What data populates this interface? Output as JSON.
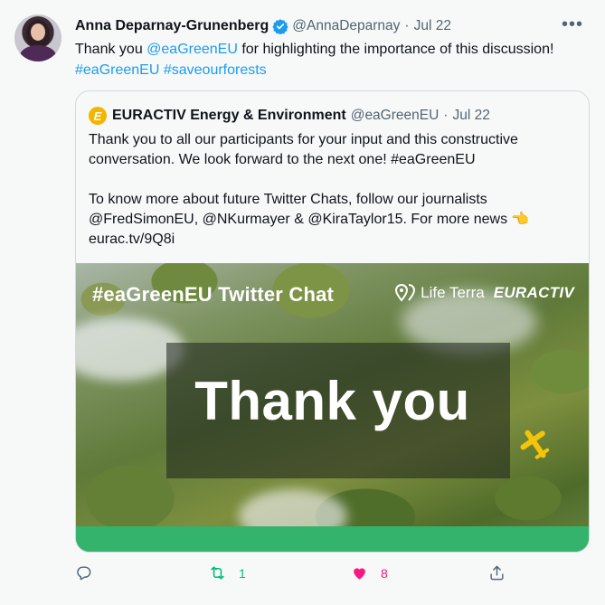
{
  "tweet": {
    "author_name": "Anna Deparnay-Grunenberg",
    "handle": "@AnnaDeparnay",
    "separator": "·",
    "date": "Jul 22",
    "more_icon": "more-horizontal-icon",
    "text_before": "Thank you ",
    "mention": "@eaGreenEU",
    "text_after": " for highlighting the importance of this discussion!",
    "hashtag1": "#eaGreenEU",
    "hashtag2": "#saveourforests"
  },
  "quote": {
    "avatar_letter": "E",
    "author_name": "EURACTIV Energy & Environment",
    "handle": "@eaGreenEU",
    "separator": "·",
    "date": "Jul 22",
    "line1": "Thank you to all our participants for your input and this constructive conversation. We look forward to the next one! #eaGreenEU",
    "line2": "To know more about future Twitter Chats, follow our journalists @FredSimonEU, @NKurmayer & @KiraTaylor15. For more news",
    "emoji": "👉",
    "link": "eurac.tv/9Q8i",
    "image": {
      "title": "#eaGreenEU Twitter Chat",
      "logo1": "Life Terra",
      "logo2": "EURACTIV",
      "headline": "Thank you"
    }
  },
  "actions": {
    "reply_count": "",
    "retweet_count": "1",
    "like_count": "8"
  },
  "colors": {
    "accent": "#1d9bf0",
    "retweet": "#00ba7c",
    "like": "#f91880"
  }
}
